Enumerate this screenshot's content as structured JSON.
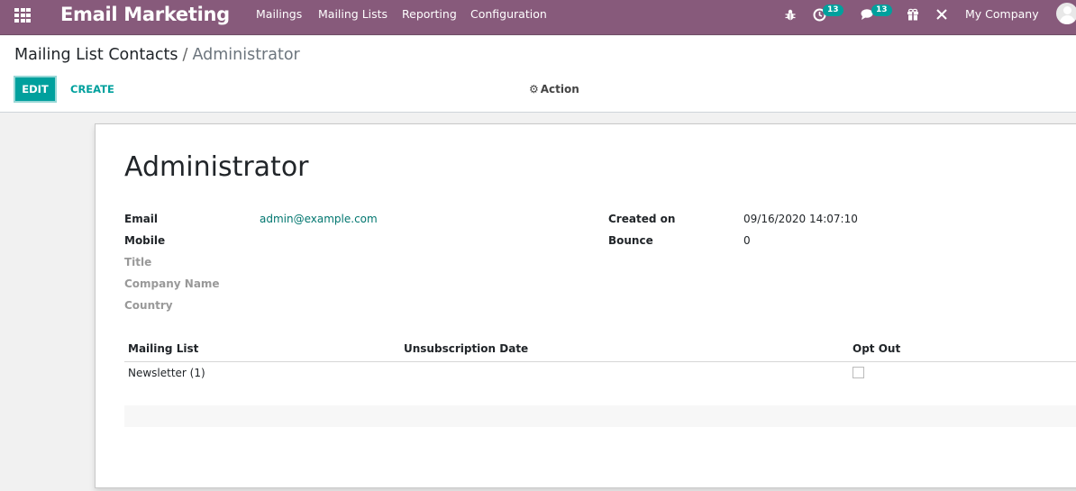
{
  "navbar": {
    "app_title": "Email Marketing",
    "menu": [
      "Mailings",
      "Mailing Lists",
      "Reporting",
      "Configuration"
    ],
    "activity_badge": "13",
    "messages_badge": "13",
    "company": "My Company",
    "colors": {
      "bar": "#875a7b",
      "badge": "#00a09d"
    }
  },
  "breadcrumb": {
    "parent": "Mailing List Contacts",
    "separator": "/",
    "current": "Administrator"
  },
  "toolbar": {
    "edit_label": "EDIT",
    "create_label": "CREATE",
    "action_label": "Action"
  },
  "record": {
    "name": "Administrator",
    "left_fields": [
      {
        "label": "Email",
        "value": "admin@example.com"
      },
      {
        "label": "Mobile",
        "value": ""
      },
      {
        "label": "Title",
        "value": ""
      },
      {
        "label": "Company Name",
        "value": ""
      },
      {
        "label": "Country",
        "value": ""
      }
    ],
    "right_fields": [
      {
        "label": "Created on",
        "value": "09/16/2020 14:07:10"
      },
      {
        "label": "Bounce",
        "value": "0"
      }
    ]
  },
  "subscriptions": {
    "columns": [
      "Mailing List",
      "Unsubscription Date",
      "Opt Out"
    ],
    "rows": [
      {
        "mailing_list": "Newsletter (1)",
        "unsubscription_date": "",
        "opt_out": false
      }
    ]
  }
}
